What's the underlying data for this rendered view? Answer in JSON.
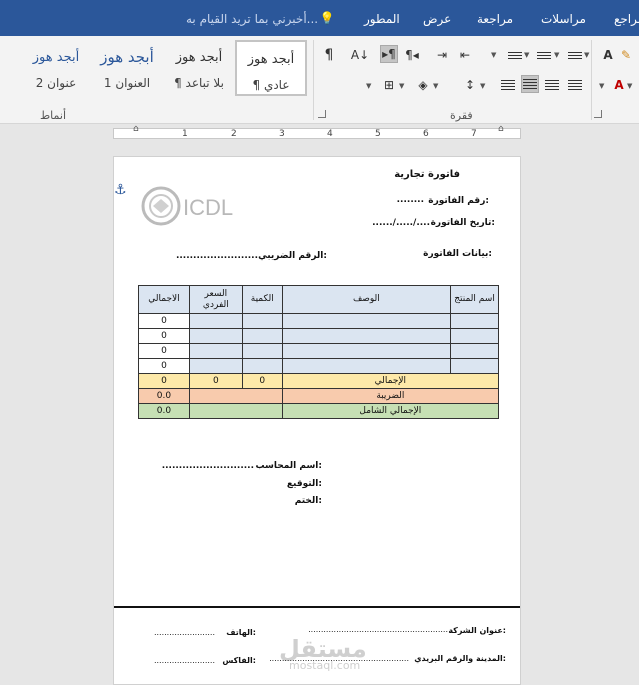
{
  "ribbon_tabs": [
    "مراجع",
    "مراسلات",
    "مراجعة",
    "عرض",
    "المطور"
  ],
  "tell_me": "أخبرني بما تريد القيام به...",
  "styles": [
    {
      "preview": "أبجد هوز",
      "name": "¶ عادي"
    },
    {
      "preview": "أبجد هوز",
      "name": "¶ بلا تباعد"
    },
    {
      "preview": "أبجد هوز",
      "name": "العنوان 1"
    },
    {
      "preview": "أبجد هوز",
      "name": "عنوان 2"
    }
  ],
  "groups": {
    "styles_label": "أنماط",
    "paragraph_label": "فقرة"
  },
  "ruler": {
    "numbers": [
      "1",
      "2",
      "3",
      "4",
      "5",
      "6",
      "7"
    ]
  },
  "invoice": {
    "title": "فاتورة تجارية",
    "number_label": "رقم الفاتورة:",
    "number_value": "........",
    "date_label": "تاريخ الفاتورة:",
    "date_value": "....../...../....",
    "data_label": "بيانات الفاتورة:",
    "tax_label": "الرقم الضريبي:",
    "tax_value": "........................",
    "logo_text": "ICDL",
    "columns": [
      "اسم المنتج",
      "الوصف",
      "الكمية",
      "السعر\nالفردي",
      "الاجمالي"
    ],
    "row_totals": [
      "0",
      "0",
      "0",
      "0"
    ],
    "total_label": "الإجمالي",
    "total_qty": "0",
    "total_price": "0",
    "total_value": "0",
    "tax_row_label": "الضريبة",
    "tax_row_value": "0.0",
    "grand_label": "الإجمالي الشامل",
    "grand_value": "0.0",
    "accountant_label": "اسم المحاسب:",
    "accountant_value": "...........................",
    "signature_label": "التوقيع:",
    "stamp_label": "الختم:"
  },
  "footer": {
    "company_address_label": "عنوان الشركة:",
    "company_address_value": ".......................................................",
    "phone_label": "الهاتف:",
    "phone_value": "........................",
    "city_label": "المدينة والرقم البريدي:",
    "city_value": ".......................................................",
    "fax_label": "الفاكس:",
    "fax_value": "........................"
  },
  "watermark": {
    "main": "مستقل",
    "sub": "mostaql.com"
  },
  "colors": {
    "ribbon_blue": "#2b579a",
    "table_blue": "#dbe5f1",
    "total_yellow": "#fde9a9",
    "tax_orange": "#f8cbad",
    "grand_green": "#c6e0b4"
  }
}
